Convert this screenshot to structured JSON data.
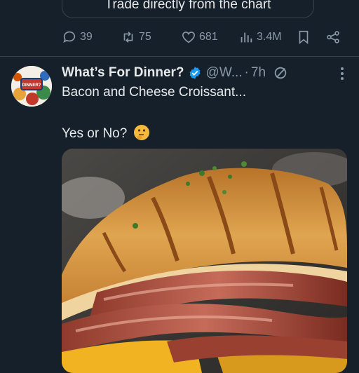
{
  "previous_tweet": {
    "card_text": "Trade directly from the chart",
    "actions": {
      "replies": "39",
      "reposts": "75",
      "likes": "681",
      "views": "3.4M"
    }
  },
  "tweet": {
    "author_name": "What’s For Dinner?",
    "handle": "@W...",
    "separator": "·",
    "time": "7h",
    "line1": "Bacon and Cheese Croissant...",
    "line2": "Yes or No?",
    "avatar_text": "WHAT'S FOR DINNER?"
  },
  "colors": {
    "background": "#15202b",
    "verified": "#1d9bf0",
    "muted": "#8b98a5"
  },
  "icons": [
    "reply-icon",
    "repost-icon",
    "like-icon",
    "views-icon",
    "bookmark-icon",
    "share-icon",
    "verified-icon",
    "grok-icon",
    "more-icon",
    "thinking-face-emoji"
  ]
}
